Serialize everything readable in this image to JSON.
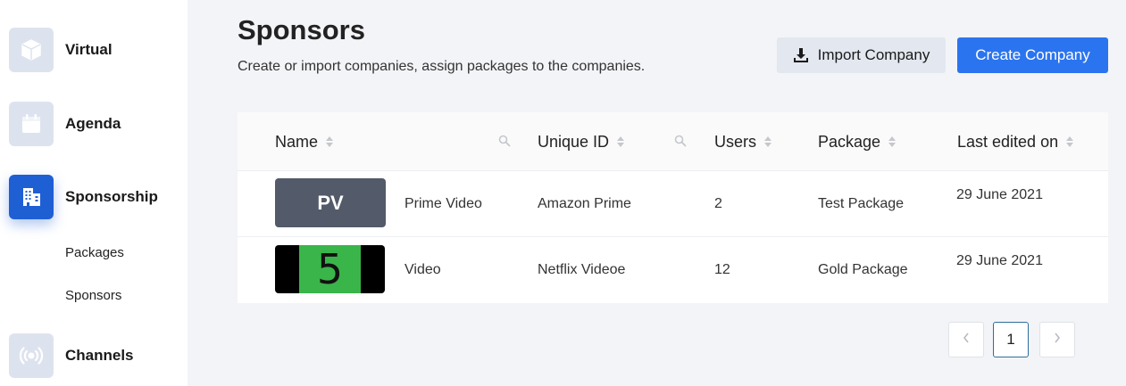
{
  "sidebar": {
    "items": [
      {
        "label": "Virtual",
        "icon": "cube-icon"
      },
      {
        "label": "Agenda",
        "icon": "calendar-icon"
      },
      {
        "label": "Sponsorship",
        "icon": "building-icon"
      },
      {
        "label": "Channels",
        "icon": "broadcast-icon"
      }
    ],
    "sub_items": [
      {
        "label": "Packages"
      },
      {
        "label": "Sponsors"
      }
    ]
  },
  "header": {
    "title": "Sponsors",
    "subtitle": "Create or import companies, assign packages to the companies.",
    "import_label": "Import Company",
    "create_label": "Create Company"
  },
  "table": {
    "columns": [
      "Name",
      "Unique ID",
      "Users",
      "Package",
      "Last edited on"
    ],
    "rows": [
      {
        "logo_text": "PV",
        "name": "Prime Video",
        "unique_id": "Amazon Prime",
        "users": "2",
        "package": "Test Package",
        "last_edited": "29 June 2021"
      },
      {
        "logo_text": "5",
        "name": "Video",
        "unique_id": "Netflix Videoe",
        "users": "12",
        "package": "Gold Package",
        "last_edited": "29 June 2021"
      }
    ]
  },
  "pagination": {
    "current_page": "1"
  },
  "colors": {
    "accent": "#2b74f0",
    "active_nav": "#1f5fd4",
    "nav_icon_bg": "#dde3ee",
    "logo_green": "#3ab54a",
    "logo_pv_bg": "#535a69"
  }
}
